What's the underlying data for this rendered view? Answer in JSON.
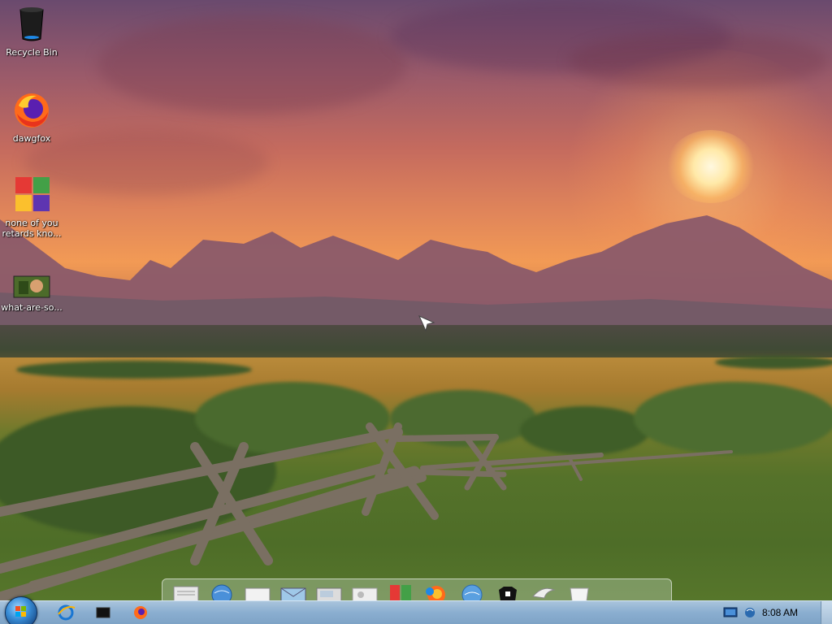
{
  "desktop_icons": [
    {
      "label": "Recycle Bin",
      "icon": "recycle-bin-icon"
    },
    {
      "label": "dawgfox",
      "icon": "firefox-icon"
    },
    {
      "label": "none of you\nretards kno...",
      "icon": "windows-flag-icon"
    },
    {
      "label": "what-are-so...",
      "icon": "image-file-icon"
    }
  ],
  "dock": {
    "items": [
      "notepad-icon",
      "globe-icon",
      "document-icon",
      "mail-icon",
      "scanner-icon",
      "photos-icon",
      "windows-flag-icon",
      "firefox-icon",
      "globe-icon",
      "user-shirt-icon",
      "bird-icon",
      "bin-icon"
    ]
  },
  "taskbar": {
    "start": "start-orb",
    "pinned": [
      "internet-explorer-icon",
      "terminal-icon",
      "firefox-icon"
    ],
    "tray_icons": [
      "monitor-icon",
      "network-icon"
    ],
    "clock": "8:08 AM"
  },
  "colors": {
    "taskbar": "#8aaed0",
    "sky_top": "#6a4a6e",
    "sun": "#fff4d6"
  }
}
